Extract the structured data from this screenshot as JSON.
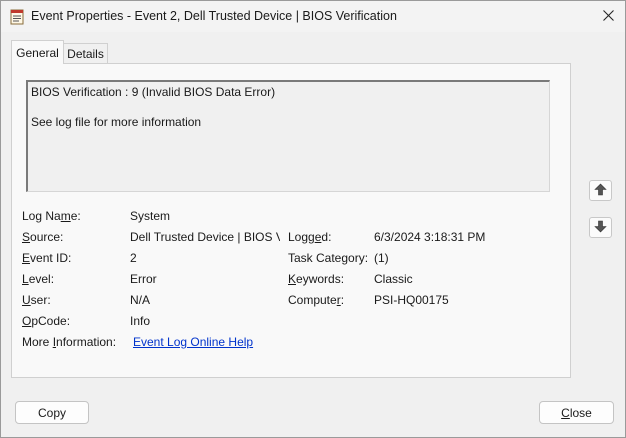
{
  "window": {
    "title": "Event Properties - Event 2, Dell Trusted Device | BIOS Verification",
    "app_icon": "event-viewer-icon",
    "close_icon": "close-icon"
  },
  "tabs": [
    {
      "label": "General",
      "selected": true
    },
    {
      "label": "Details",
      "selected": false
    }
  ],
  "description": {
    "line1": "BIOS Verification : 9 (Invalid BIOS Data Error)",
    "line2": "See log file for more information"
  },
  "fields": {
    "log_name": {
      "pre": "Log Na",
      "key": "m",
      "post": "e:",
      "value": "System"
    },
    "source": {
      "pre": "",
      "key": "S",
      "post": "ource:",
      "value": "Dell Trusted Device | BIOS Ve"
    },
    "event_id": {
      "pre": "",
      "key": "E",
      "post": "vent ID:",
      "value": "2"
    },
    "level": {
      "pre": "",
      "key": "L",
      "post": "evel:",
      "value": "Error"
    },
    "user": {
      "pre": "",
      "key": "U",
      "post": "ser:",
      "value": "N/A"
    },
    "opcode": {
      "pre": "",
      "key": "O",
      "post": "pCode:",
      "value": "Info"
    },
    "more_info": {
      "pre": "More ",
      "key": "I",
      "post": "nformation:",
      "value": "Event Log Online Help"
    },
    "logged": {
      "pre": "Logg",
      "key": "e",
      "post": "d:",
      "value": "6/3/2024 3:18:31 PM"
    },
    "task_category": {
      "pre": "Task Category:",
      "key": "",
      "post": "",
      "value": "(1)"
    },
    "keywords": {
      "pre": "",
      "key": "K",
      "post": "eywords:",
      "value": "Classic"
    },
    "computer": {
      "pre": "Compute",
      "key": "r",
      "post": ":",
      "value": "PSI-HQ00175"
    }
  },
  "nav": {
    "up_icon": "arrow-up-icon",
    "down_icon": "arrow-down-icon"
  },
  "buttons": {
    "copy": {
      "pre": "",
      "key": "",
      "post": "Copy"
    },
    "close": {
      "pre": "",
      "key": "C",
      "post": "lose"
    }
  }
}
